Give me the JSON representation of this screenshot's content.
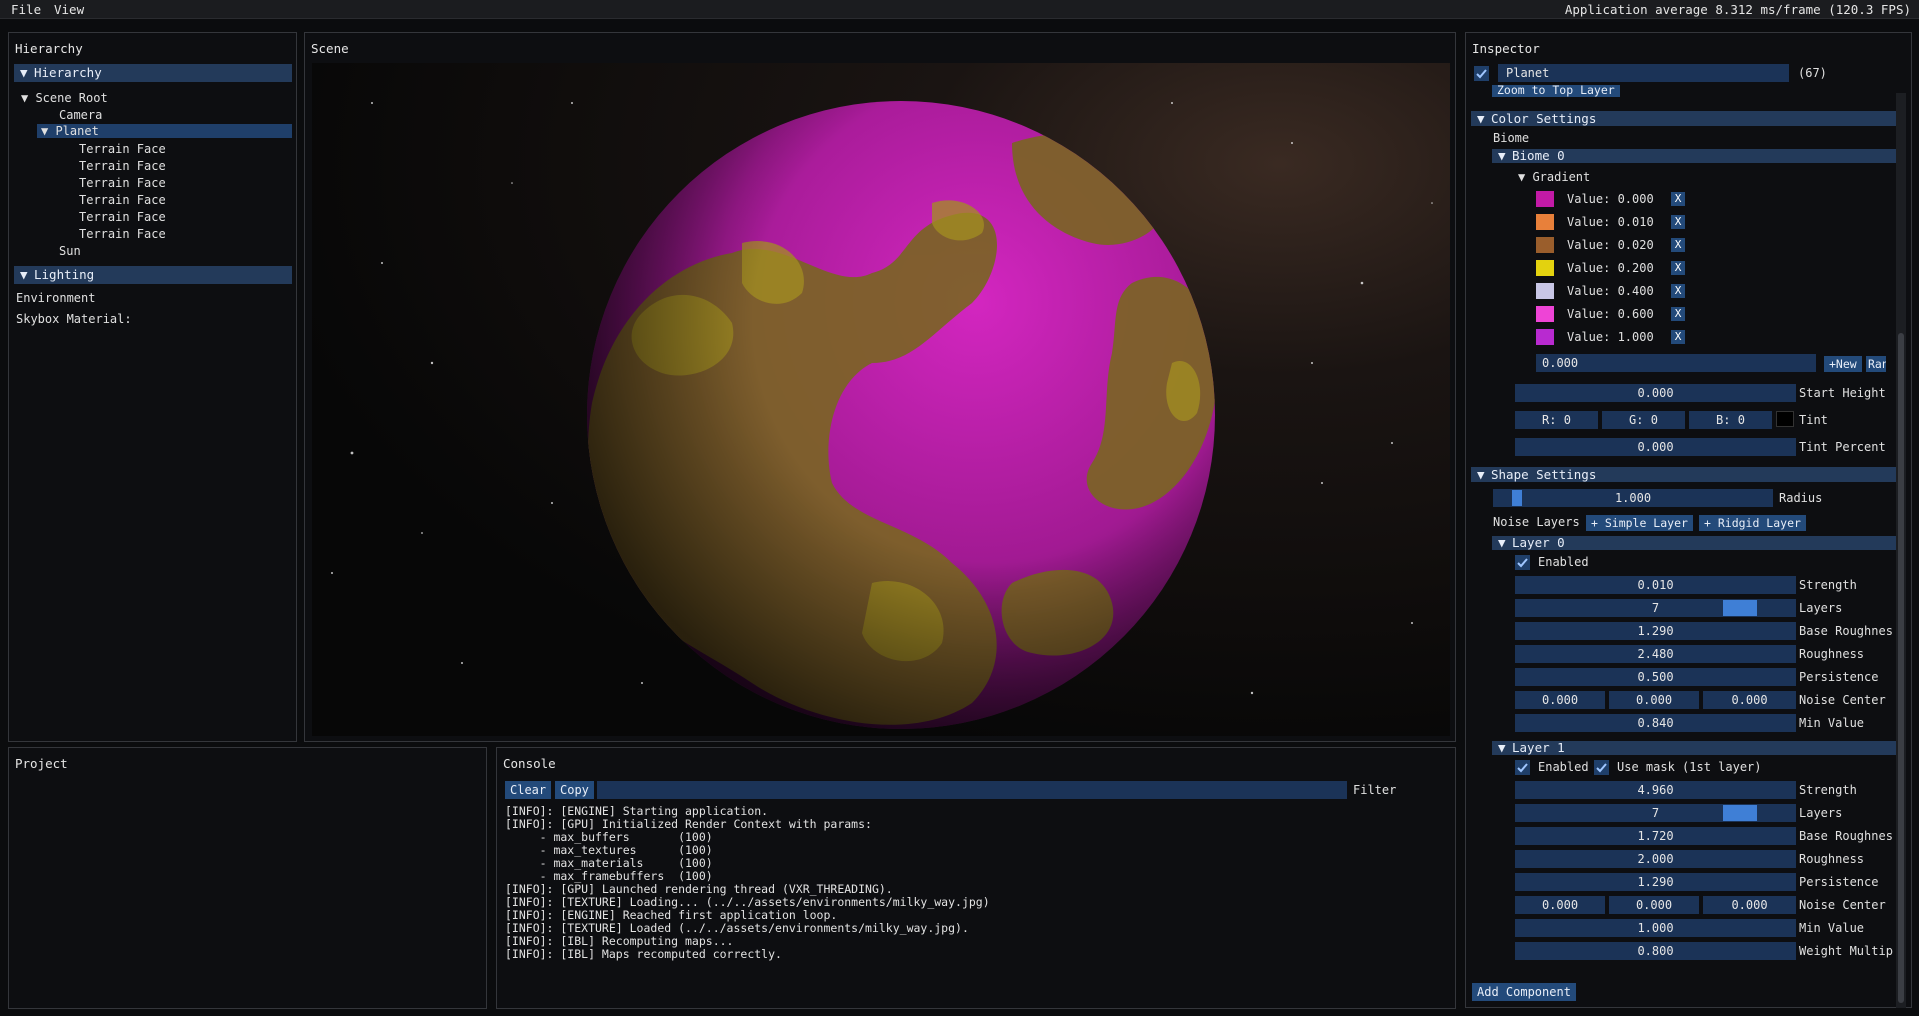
{
  "menu": {
    "file": "File",
    "view": "View"
  },
  "status": {
    "fps": "Application average 8.312 ms/frame (120.3 FPS)"
  },
  "hierarchy": {
    "title": "Hierarchy",
    "header": "Hierarchy",
    "scene_root": "Scene Root",
    "camera": "Camera",
    "planet": "Planet",
    "terrain_faces": [
      "Terrain Face",
      "Terrain Face",
      "Terrain Face",
      "Terrain Face",
      "Terrain Face",
      "Terrain Face"
    ],
    "sun": "Sun",
    "lighting_header": "Lighting",
    "environment": "Environment",
    "skybox_material": "Skybox Material:"
  },
  "scene": {
    "title": "Scene"
  },
  "project": {
    "title": "Project"
  },
  "console": {
    "title": "Console",
    "clear": "Clear",
    "copy": "Copy",
    "filter_label": "Filter",
    "lines": [
      "[INFO]: [ENGINE] Starting application.",
      "[INFO]: [GPU] Initialized Render Context with params:",
      "     - max_buffers       (100)",
      "     - max_textures      (100)",
      "     - max_materials     (100)",
      "     - max_framebuffers  (100)",
      "[INFO]: [GPU] Launched rendering thread (VXR_THREADING).",
      "[INFO]: [TEXTURE] Loading... (../../assets/environments/milky_way.jpg)",
      "[INFO]: [ENGINE] Reached first application loop.",
      "[INFO]: [TEXTURE] Loaded (../../assets/environments/milky_way.jpg).",
      "[INFO]: [IBL] Recomputing maps...",
      "[INFO]: [IBL] Maps recomputed correctly."
    ]
  },
  "inspector": {
    "title": "Inspector",
    "object_name": "Planet",
    "object_id": "(67)",
    "zoom_button": "Zoom to Top Layer",
    "color_settings": "Color Settings",
    "biome_label": "Biome",
    "biome0": "Biome 0",
    "gradient": "Gradient",
    "gradient_stops": [
      {
        "color": "#c21aa6",
        "label": "Value: 0.000",
        "x": "X"
      },
      {
        "color": "#e8803a",
        "label": "Value: 0.010",
        "x": "X"
      },
      {
        "color": "#9a5e2c",
        "label": "Value: 0.020",
        "x": "X"
      },
      {
        "color": "#e3d20f",
        "label": "Value: 0.200",
        "x": "X"
      },
      {
        "color": "#c8c6e6",
        "label": "Value: 0.400",
        "x": "X"
      },
      {
        "color": "#ee44d6",
        "label": "Value: 0.600",
        "x": "X"
      },
      {
        "color": "#b82ad0",
        "label": "Value: 1.000",
        "x": "X"
      }
    ],
    "new_value": "0.000",
    "new_button": "+New",
    "ran_button": "Ran",
    "start_height": {
      "value": "0.000",
      "label": "Start Height"
    },
    "tint": {
      "r": "R:  0",
      "g": "G:  0",
      "b": "B:  0",
      "label": "Tint",
      "swatch": "#000000"
    },
    "tint_percent": {
      "value": "0.000",
      "label": "Tint Percent"
    },
    "shape_settings": "Shape Settings",
    "radius": {
      "value": "1.000",
      "label": "Radius",
      "fraction": 0.07
    },
    "noise_layers_label": "Noise Layers",
    "simple_layer_button": "+ Simple Layer",
    "ridgid_layer_button": "+ Ridgid Layer",
    "layer0": {
      "header": "Layer 0",
      "enabled": "Enabled",
      "strength": {
        "value": "0.010",
        "label": "Strength"
      },
      "layers": {
        "value": "7",
        "label": "Layers"
      },
      "base_roughness": {
        "value": "1.290",
        "label": "Base Roughnes"
      },
      "roughness": {
        "value": "2.480",
        "label": "Roughness"
      },
      "persistence": {
        "value": "0.500",
        "label": "Persistence"
      },
      "noise_center": {
        "x": "0.000",
        "y": "0.000",
        "z": "0.000",
        "label": "Noise Center"
      },
      "min_value": {
        "value": "0.840",
        "label": "Min Value"
      }
    },
    "layer1": {
      "header": "Layer 1",
      "enabled": "Enabled",
      "use_mask": "Use mask (1st layer)",
      "strength": {
        "value": "4.960",
        "label": "Strength"
      },
      "layers": {
        "value": "7",
        "label": "Layers"
      },
      "base_roughness": {
        "value": "1.720",
        "label": "Base Roughnes"
      },
      "roughness": {
        "value": "2.000",
        "label": "Roughness"
      },
      "persistence": {
        "value": "1.290",
        "label": "Persistence"
      },
      "noise_center": {
        "x": "0.000",
        "y": "0.000",
        "z": "0.000",
        "label": "Noise Center"
      },
      "min_value": {
        "value": "1.000",
        "label": "Min Value"
      },
      "weight_multiplier": {
        "value": "0.800",
        "label": "Weight Multip"
      }
    },
    "add_component": "Add Component"
  }
}
